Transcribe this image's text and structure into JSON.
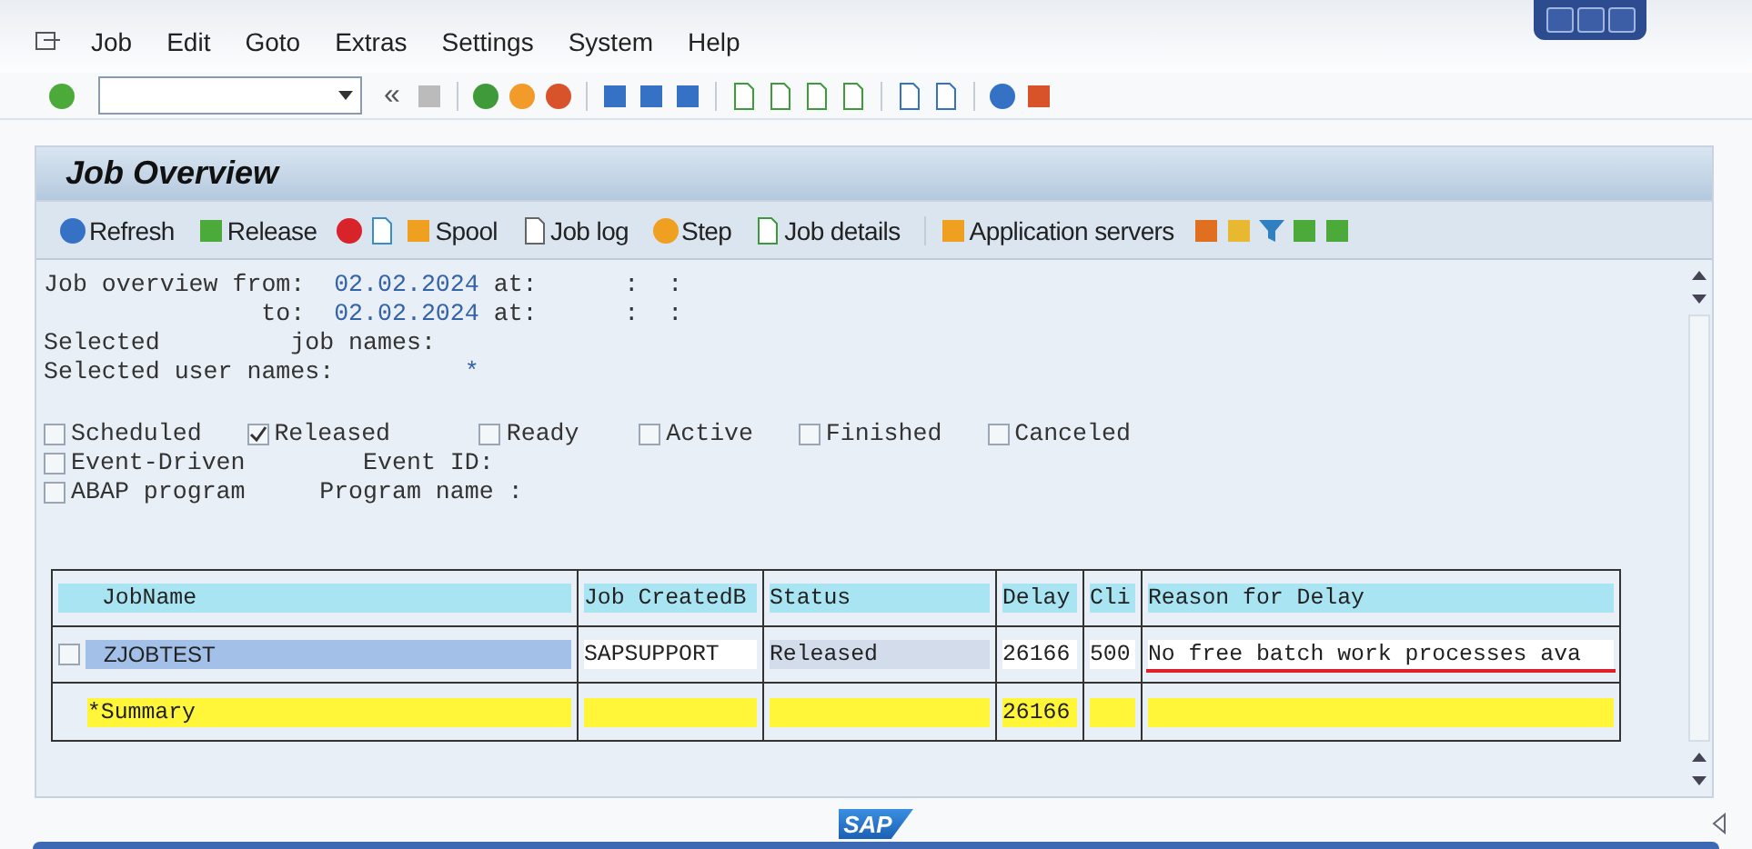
{
  "menu": [
    {
      "label": "Job"
    },
    {
      "label": "Edit"
    },
    {
      "label": "Goto"
    },
    {
      "label": "Extras"
    },
    {
      "label": "Settings"
    },
    {
      "label": "System"
    },
    {
      "label": "Help"
    }
  ],
  "toolbar": {
    "history_glyph": "«"
  },
  "title": "Job Overview",
  "app_toolbar": [
    "Refresh",
    "Release",
    "Spool",
    "Job log",
    "Step",
    "Job details",
    "Application servers"
  ],
  "criteria": [
    {
      "label": "Job overview from:",
      "date": "02.02.2024",
      "at_label": "at:",
      "time": ":  :"
    },
    {
      "label": "to:",
      "date": "02.02.2024",
      "at_label": "at:",
      "time": ":  :"
    }
  ],
  "job_names": {
    "label": "Selected",
    "label_2": "job names:"
  },
  "user_names": {
    "label": "Selected user names:",
    "value": "*"
  },
  "status_filters": [
    {
      "label": "Scheduled",
      "checked": false
    },
    {
      "label": "Released",
      "checked": true
    },
    {
      "label": "Ready",
      "checked": false
    },
    {
      "label": "Active",
      "checked": false
    },
    {
      "label": "Finished",
      "checked": false
    },
    {
      "label": "Canceled",
      "checked": false
    }
  ],
  "event_driven": {
    "label": "Event-Driven",
    "checked": false,
    "field_label": "Event ID:"
  },
  "abap_program": {
    "label": "ABAP program",
    "checked": false,
    "field_label": "Program name :"
  },
  "table": {
    "columns": [
      "JobName",
      "Job CreatedB",
      "Status",
      "Delay",
      "Cli",
      "Reason for Delay"
    ],
    "rows": [
      {
        "kind": "job",
        "selected": false,
        "cells": [
          "ZJOBTEST",
          "SAPSUPPORT",
          "Released",
          "26166",
          "500",
          "No free batch work processes ava"
        ],
        "underlined": true
      },
      {
        "kind": "summary",
        "cells": [
          "*Summary",
          "",
          "",
          "26166",
          "",
          ""
        ]
      }
    ]
  },
  "logo": "SAP"
}
